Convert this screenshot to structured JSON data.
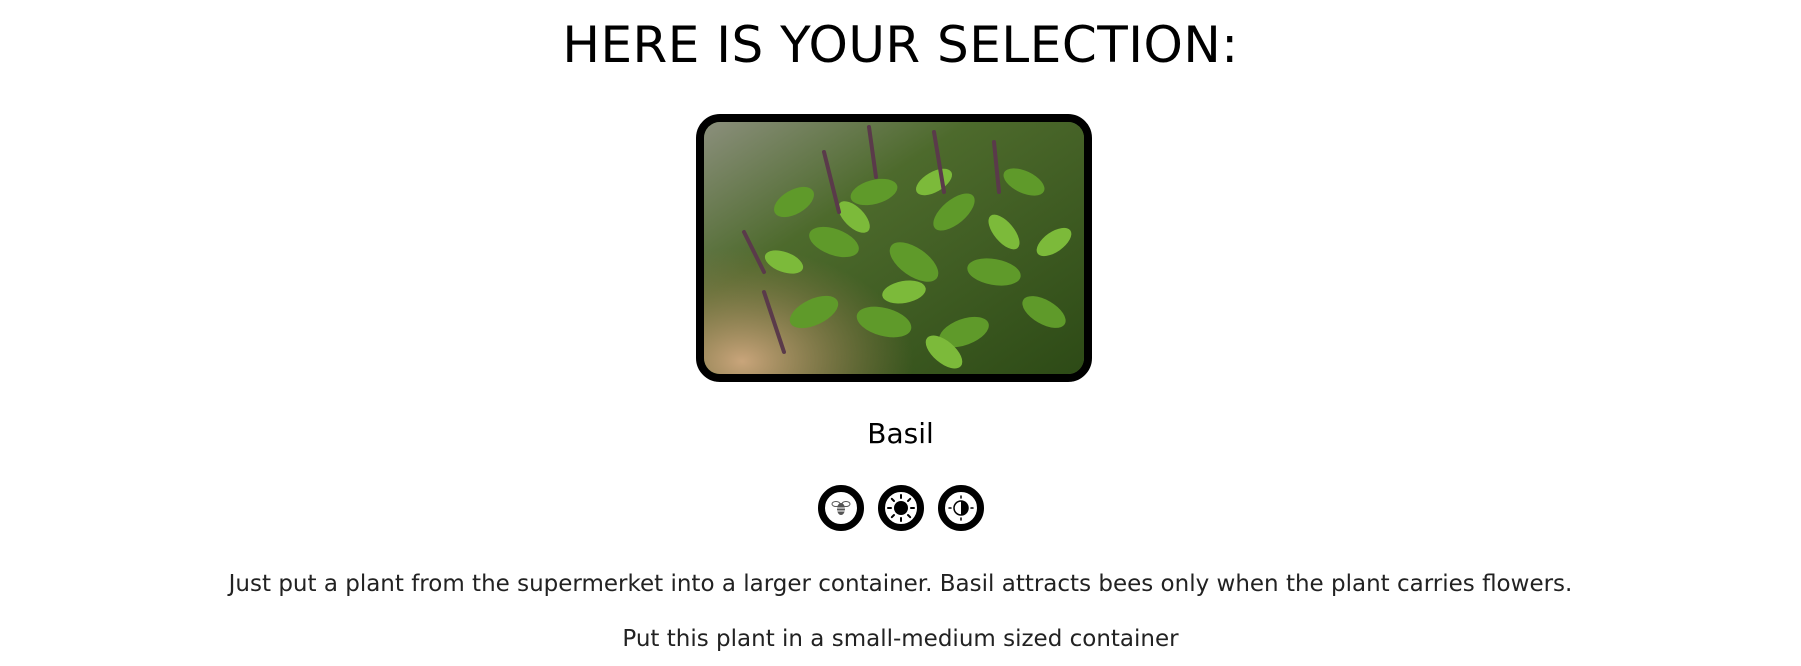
{
  "selection": {
    "heading": "HERE IS YOUR SELECTION:",
    "plant_name": "Basil",
    "description": "Just put a plant from the supermerket into a larger container. Basil attracts bees only when the plant carries flowers.",
    "container_note": "Put this plant in a small-medium sized container",
    "photo_alt": "Basil",
    "attribute_icons": [
      "bee-icon",
      "full-sun-icon",
      "partial-shade-icon"
    ]
  }
}
